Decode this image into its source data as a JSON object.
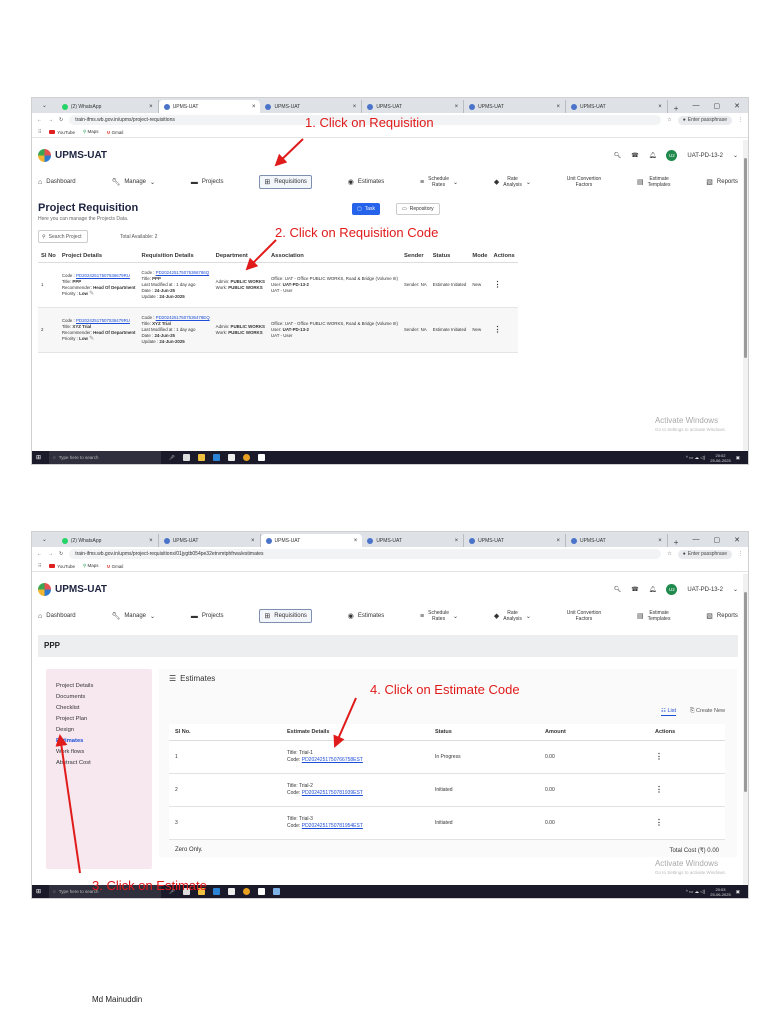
{
  "browser": {
    "tabs": [
      "(2) WhatsApp",
      "UPMS-UAT",
      "UPMS-UAT",
      "UPMS-UAT",
      "UPMS-UAT",
      "UPMS-UAT"
    ],
    "url1": "train-ifms.wb.gov.in/upms/project-requisitions",
    "url2": "train-ifms.wb.gov.in/upms/project-requisitions/01jygtb054pe32etrvmtphfrwa/estimates",
    "passphrase": "Enter passphrase",
    "bookmarks": [
      "YouTube",
      "Maps",
      "Gmail"
    ]
  },
  "app": {
    "brand": "UPMS-UAT",
    "user": "UAT-PD-13-2",
    "avatar": "U2",
    "nav": {
      "dashboard": "Dashboard",
      "manage": "Manage",
      "projects": "Projects",
      "requisitions": "Requisitions",
      "estimates": "Estimates",
      "schedule1": "Schedule",
      "schedule2": "Rates",
      "rate1": "Rate",
      "rate2": "Analysis",
      "unit1": "Unit Convertion",
      "unit2": "Factors",
      "et1": "Estimate",
      "et2": "Templates",
      "reports": "Reports"
    }
  },
  "screen1": {
    "title": "Project Requisition",
    "subtitle": "Here you can manage the Projects Data.",
    "task_btn": "Task",
    "repo_btn": "Repository",
    "search_placeholder": "Search Project",
    "total": "Total Available: 2",
    "headers": [
      "Sl No",
      "Project Details",
      "Requisition Details",
      "Department",
      "Association",
      "Sender",
      "Status",
      "Mode",
      "Actions"
    ],
    "rows": [
      {
        "sl": "1",
        "p_code_label": "Code : ",
        "p_code": "PD20242517507636679RU",
        "p_title_label": "Title: ",
        "p_title": "PPP",
        "p_rec_label": "Recommender: ",
        "p_rec": "Head Of Department",
        "p_pri_label": "Priority : ",
        "p_pri": "Low",
        "r_code_label": "Code : ",
        "r_code": "PD202425175076366786Q",
        "r_title_label": "Title: ",
        "r_title": "PPP",
        "r_mod": "Last Modified at : 1 day ago",
        "r_date_label": "Date : ",
        "r_date": "24-Jun-25",
        "r_upd_label": "Update : ",
        "r_upd": "24-Jun-2025",
        "d_admin_label": "Admin: ",
        "d_admin": "PUBLIC WORKS",
        "d_work_label": "Work: ",
        "d_work": "PUBLIC WORKS",
        "a_office": "Office: UAT - Office PUBLIC WORKS, Road & Bridge (Volume III)",
        "a_user_label": "User: ",
        "a_user": "UAT-PD-13-2",
        "a_role": "UAT - User",
        "sender": "Sender: NA",
        "status": "Estimate Initiated",
        "mode": "New"
      },
      {
        "sl": "2",
        "p_code_label": "Code : ",
        "p_code": "PD20242517507536479RU",
        "p_title_label": "Title: ",
        "p_title": "XYZ Trial",
        "p_rec_label": "Recommender: ",
        "p_rec": "Head Of Department",
        "p_pri_label": "Priority : ",
        "p_pri": "Low",
        "r_code_label": "Code : ",
        "r_code": "PD20242517507536478EQ",
        "r_title_label": "Title: ",
        "r_title": "XYZ Trial",
        "r_mod": "Last Modified at : 1 day ago",
        "r_date_label": "Date : ",
        "r_date": "24-Jun-25",
        "r_upd_label": "Update : ",
        "r_upd": "24-Jun-2025",
        "d_admin_label": "Admin: ",
        "d_admin": "PUBLIC WORKS",
        "d_work_label": "Work: ",
        "d_work": "PUBLIC WORKS",
        "a_office": "Office: UAT - Office PUBLIC WORKS, Road & Bridge (Volume III)",
        "a_user_label": "User: ",
        "a_user": "UAT-PD-13-2",
        "a_role": "UAT - User",
        "sender": "Sender: NA",
        "status": "Estimate Initiated",
        "mode": "New"
      }
    ],
    "watermark_title": "Activate Windows",
    "watermark_sub": "Go to Settings to activate Windows.",
    "clock_time": "20:02",
    "clock_date": "25-06-2025"
  },
  "screen2": {
    "project": "PPP",
    "side": [
      "Project Details",
      "Documents",
      "Checklist",
      "Project Plan",
      "Design",
      "Estimates",
      "Work flows",
      "Abstract Cost"
    ],
    "panel_title": "Estimates",
    "list_btn": "List",
    "create_btn": "Create New",
    "headers": [
      "Sl No.",
      "Estimate Details",
      "Status",
      "Amount",
      "Actions"
    ],
    "rows": [
      {
        "sl": "1",
        "title": "Title: Trial-1",
        "code_label": "Code: ",
        "code": "PD2024251750766758EST",
        "status": "In Progress",
        "amount": "0.00"
      },
      {
        "sl": "2",
        "title": "Title: Trial-2",
        "code_label": "Code: ",
        "code": "PD2024251750781939EST",
        "status": "Initiated",
        "amount": "0.00"
      },
      {
        "sl": "3",
        "title": "Title: Trial-3",
        "code_label": "Code: ",
        "code": "PD2024251750781954EST",
        "status": "Initiated",
        "amount": "0.00"
      }
    ],
    "zero": "Zero Only.",
    "total_cost": "Total Cost (₹) 0.00",
    "watermark_title": "Activate Windows",
    "watermark_sub": "Go to Settings to activate Windows.",
    "clock_time": "20:03",
    "clock_date": "25-06-2025"
  },
  "taskbar": {
    "search": "Type here to search"
  },
  "annotations": {
    "a1": "1. Click on Requisition",
    "a2": "2. Click on Requisition Code",
    "a3": "3. Click on Estimate",
    "a4": "4. Click on Estimate Code"
  },
  "author": "Md Mainuddin",
  "colors": {
    "annotation": "#e01b1b",
    "link": "#1d4ed8",
    "primary": "#2563eb",
    "brand_text": "#1d2340"
  }
}
